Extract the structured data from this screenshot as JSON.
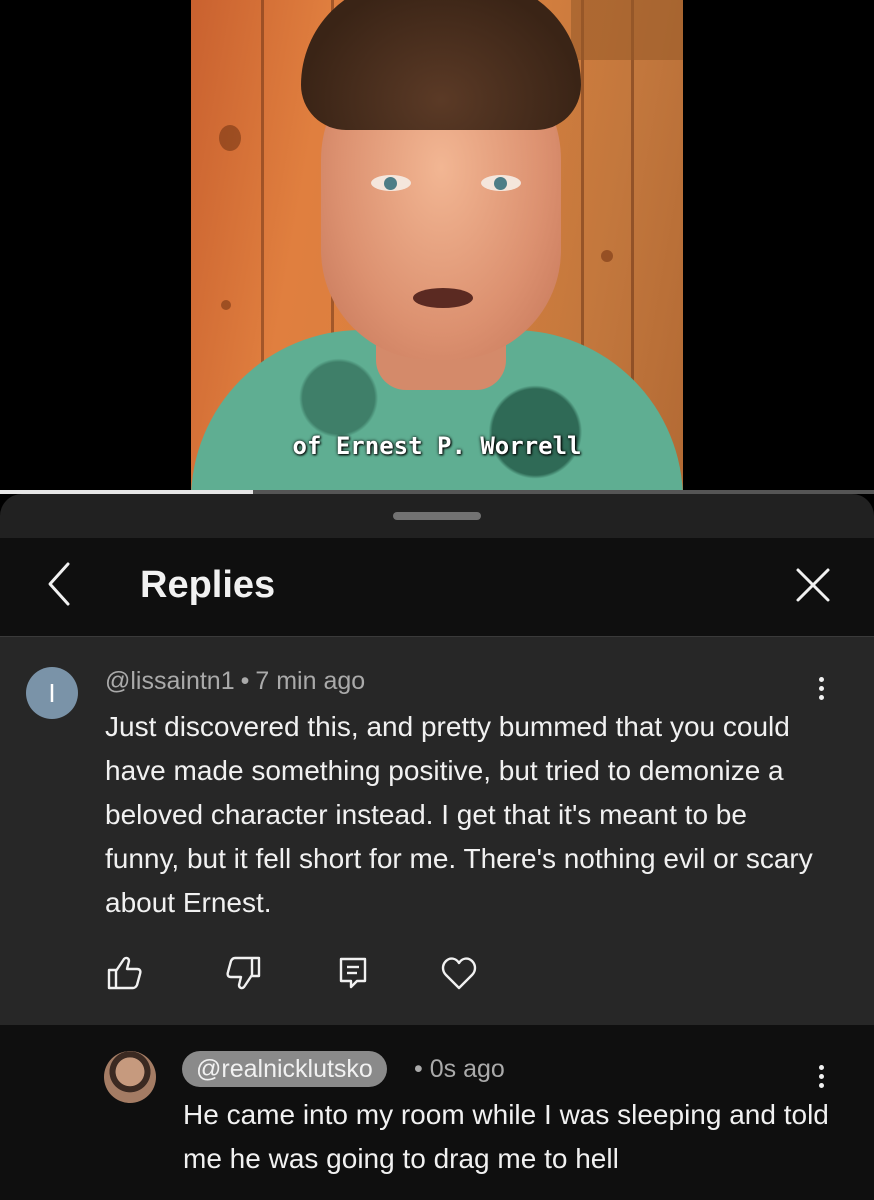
{
  "video": {
    "caption": "of Ernest P. Worrell",
    "progress_fraction": 0.29
  },
  "sheet": {
    "title": "Replies"
  },
  "parent_comment": {
    "avatar_letter": "I",
    "author": "@lissaintn1",
    "separator": "•",
    "time": "7 min ago",
    "text": "Just discovered this, and pretty bummed that you could have made something positive, but tried to demonize a beloved character instead. I get that it's meant to be funny, but it fell short for me. There's nothing evil or scary about Ernest.",
    "actions": [
      "thumbs-up-icon",
      "thumbs-down-icon",
      "reply-icon",
      "heart-icon"
    ]
  },
  "reply": {
    "author": "@realnicklutsko",
    "separator": "•",
    "time": "0s ago",
    "text": "He came into my room while I was sleeping and told me he was going to drag me to hell"
  },
  "colors": {
    "sheet_bg": "#212121",
    "header_bg": "#0f0f0f",
    "comment_bg": "#272727",
    "muted_text": "#aaaaaa",
    "primary_text": "#f1f1f1"
  }
}
